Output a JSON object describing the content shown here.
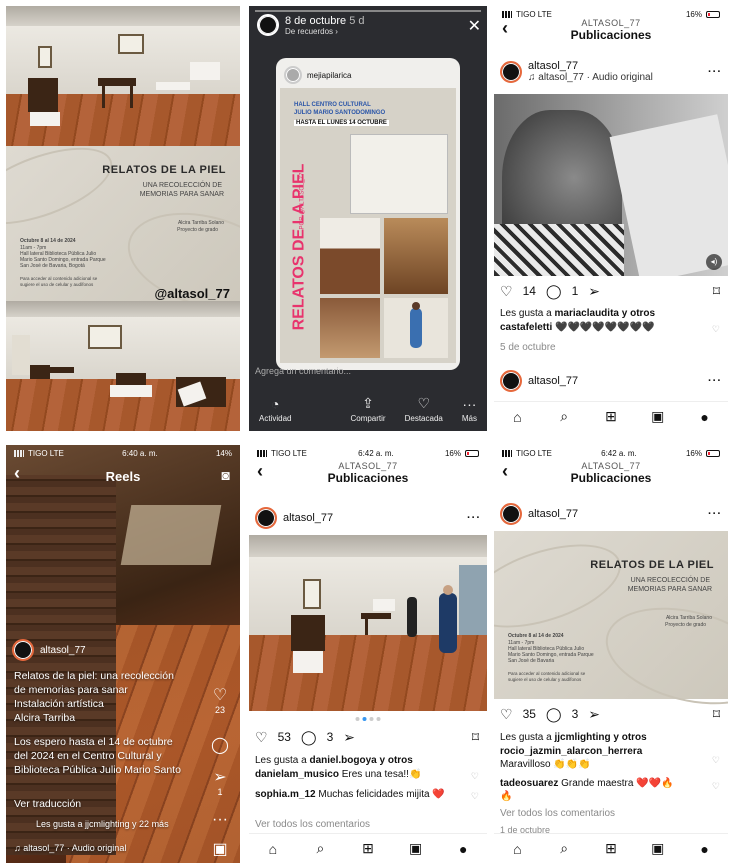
{
  "p1": {
    "poster_title": "RELATOS DE LA PIEL",
    "poster_subtitle_1": "UNA RECOLECCIÓN DE",
    "poster_subtitle_2": "MEMORIAS PARA SANAR",
    "poster_author": "Alcira Tarriba Solano",
    "poster_project": "Proyecto de grado",
    "poster_dates": "Octubre 8 al 14 de 2024",
    "poster_hours": "11am - 7pm",
    "poster_venue_1": "Hall lateral Biblioteca Pública Julio",
    "poster_venue_2": "Mario Santo Domingo, entrada Parque",
    "poster_venue_3": "San José de Bavaria, Bogotá",
    "poster_note_1": "Para acceder al contenido adicional se",
    "poster_note_2": "sugiere el uso de celular y audífonos",
    "handle": "@altasol_77"
  },
  "p2": {
    "date": "8 de octubre",
    "age": "5 d",
    "from": "De recuerdos ›",
    "sticker_user": "mejiapilarica",
    "hall_1": "HALL CENTRO CULTURAL",
    "hall_2": "JULIO MARIO SANTODOMINGO",
    "until": "HASTA EL LUNES 14 OCTUBRE",
    "vertical_title": "RELATOS DE LA PIEL",
    "vertical_by": "POR @ALTASOL_77",
    "comment_placeholder": "Agrega un comentario...",
    "btn_activity": "Actividad",
    "btn_share": "Compartir",
    "btn_featured": "Destacada",
    "btn_more": "Más"
  },
  "p3": {
    "carrier": "TIGO  LTE",
    "time": "6:42 a. m.",
    "battery": "16%",
    "account": "ALTASOL_77",
    "section": "Publicaciones",
    "user": "altasol_77",
    "audio": "♫ altasol_77 · Audio original",
    "likes_count": "14",
    "comments_count": "1",
    "liked_by_prefix": "Les gusta a ",
    "liked_by_user": "mariaclaudita",
    "liked_by_suffix": " y otros",
    "comment_user": "castafeletti",
    "comment_text": " 🖤🖤🖤🖤🖤🖤🖤🖤",
    "date": "5 de octubre",
    "next_user": "altasol_77"
  },
  "p4": {
    "carrier": "TIGO  LTE",
    "time": "6:40 a. m.",
    "battery": "14%",
    "title": "Reels",
    "user": "altasol_77",
    "caption_1": "Relatos de la piel: una recolección",
    "caption_2": "de memorias para sanar",
    "caption_3": "Instalación artística",
    "caption_4": "Alcira Tarriba",
    "caption_5": "Los espero hasta el 14 de octubre",
    "caption_6": "del 2024 en el Centro Cultural y",
    "caption_7": "Biblioteca Pública Julio Mario Santo",
    "translate": "Ver traducción",
    "likes": "Les gusta a jjcmlighting y 22 más",
    "audio": "♫ altasol_77 · Audio original",
    "like_count": "23",
    "share_count": "1"
  },
  "p5": {
    "carrier": "TIGO  LTE",
    "time": "6:42 a. m.",
    "battery": "16%",
    "account": "ALTASOL_77",
    "section": "Publicaciones",
    "user": "altasol_77",
    "likes_count": "53",
    "comments_count": "3",
    "liked_by_prefix": "Les gusta a ",
    "liked_by_user": "daniel.bogoya",
    "liked_by_suffix": " y otros",
    "c1_user": "danielam_musico",
    "c1_text": " Eres una tesa!!👏",
    "c2_user": "sophia.m_12",
    "c2_text": " Muchas felicidades mijita ❤️",
    "view_all": "Ver todos los comentarios"
  },
  "p6": {
    "carrier": "TIGO  LTE",
    "time": "6:42 a. m.",
    "battery": "16%",
    "account": "ALTASOL_77",
    "section": "Publicaciones",
    "user": "altasol_77",
    "poster_title": "RELATOS DE LA PIEL",
    "poster_subtitle_1": "UNA RECOLECCIÓN DE",
    "poster_subtitle_2": "MEMORIAS PARA SANAR",
    "poster_author": "Alcira Tarriba Solano",
    "poster_project": "Proyecto de grado",
    "poster_dates": "Octubre 8 al 14 de 2024",
    "poster_hours": "11am - 7pm",
    "poster_venue_1": "Hall lateral Biblioteca Pública Julio",
    "poster_venue_2": "Mario Santo Domingo, entrada Parque",
    "poster_venue_3": "San José de Bavaria",
    "poster_note_1": "Para acceder al contenido adicional se",
    "poster_note_2": "sugiere el uso de celular y audífonos",
    "likes_count": "35",
    "comments_count": "3",
    "liked_by_prefix": "Les gusta a ",
    "liked_by_user": "jjcmlighting",
    "liked_by_suffix": " y otros",
    "c1_user": "rocio_jazmin_alarcon_herrera",
    "c1_text": "Maravilloso 👏👏👏",
    "c2_user": "tadeosuarez",
    "c2_text": " Grande maestra ❤️❤️🔥",
    "c2_text2": "🔥",
    "view_all": "Ver todos los comentarios",
    "date": "1 de octubre"
  }
}
